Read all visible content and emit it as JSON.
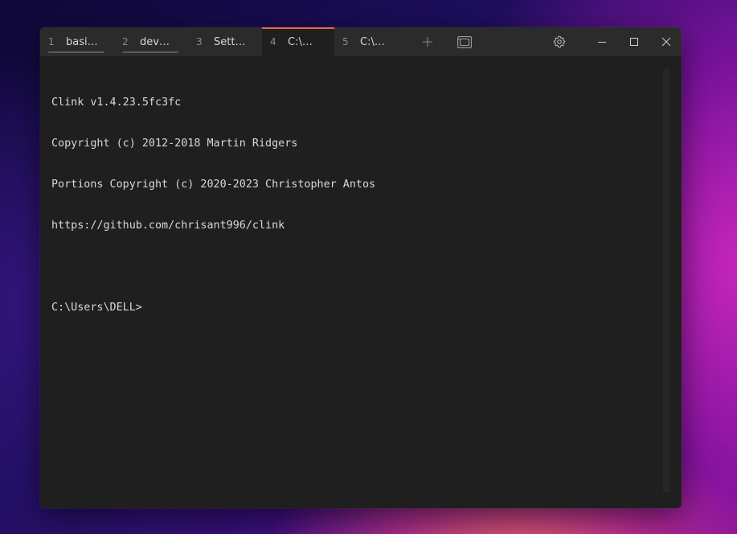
{
  "tabs": [
    {
      "num": "1",
      "label": "basi…",
      "active": false
    },
    {
      "num": "2",
      "label": "dev…",
      "active": false
    },
    {
      "num": "3",
      "label": "Sett…",
      "active": false
    },
    {
      "num": "4",
      "label": "C:\\…",
      "active": true
    },
    {
      "num": "5",
      "label": "C:\\…",
      "active": false
    }
  ],
  "titlebar": {
    "new_tab_icon": "plus-icon",
    "tab_overview_icon": "tab-overview-icon",
    "settings_icon": "gear-icon",
    "minimize_icon": "minimize-icon",
    "maximize_icon": "maximize-icon",
    "close_icon": "close-icon"
  },
  "terminal": {
    "lines": [
      "Clink v1.4.23.5fc3fc",
      "Copyright (c) 2012-2018 Martin Ridgers",
      "Portions Copyright (c) 2020-2023 Christopher Antos",
      "https://github.com/chrisant996/clink",
      "",
      "C:\\Users\\DELL>"
    ]
  },
  "colors": {
    "accent": "#e8664e",
    "titlebar": "#2b2b2b",
    "terminal_bg": "#1f1f1f",
    "text": "#d8d8d8"
  }
}
